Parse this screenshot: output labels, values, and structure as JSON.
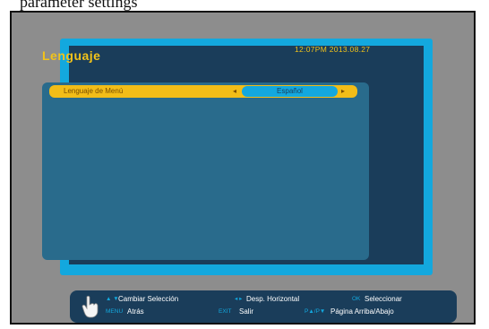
{
  "caption": "parameter settings",
  "screen": {
    "title": "Lenguaje",
    "datetime": "12:07PM  2013.08.27"
  },
  "menu": {
    "label": "Lenguaje de Menú",
    "value": "Español",
    "arrow_left": "◂",
    "arrow_right": "▸"
  },
  "footer": {
    "row1": [
      {
        "key": "▲ ▼",
        "text": "Cambiar Selección"
      },
      {
        "key": "◂ ▸",
        "text": "Desp. Horizontal"
      },
      {
        "key": "OK",
        "text": "Seleccionar"
      }
    ],
    "row2": [
      {
        "key": "MENU",
        "text": "Atrás"
      },
      {
        "key": "EXIT",
        "text": "Salir"
      },
      {
        "key": "P▲/P▼",
        "text": "Página Arriba/Abajo"
      }
    ]
  },
  "colors": {
    "panel_border": "#13a8de",
    "panel_bg": "#1a3d5a",
    "highlight": "#f2bd18",
    "title": "#f2c31a"
  }
}
